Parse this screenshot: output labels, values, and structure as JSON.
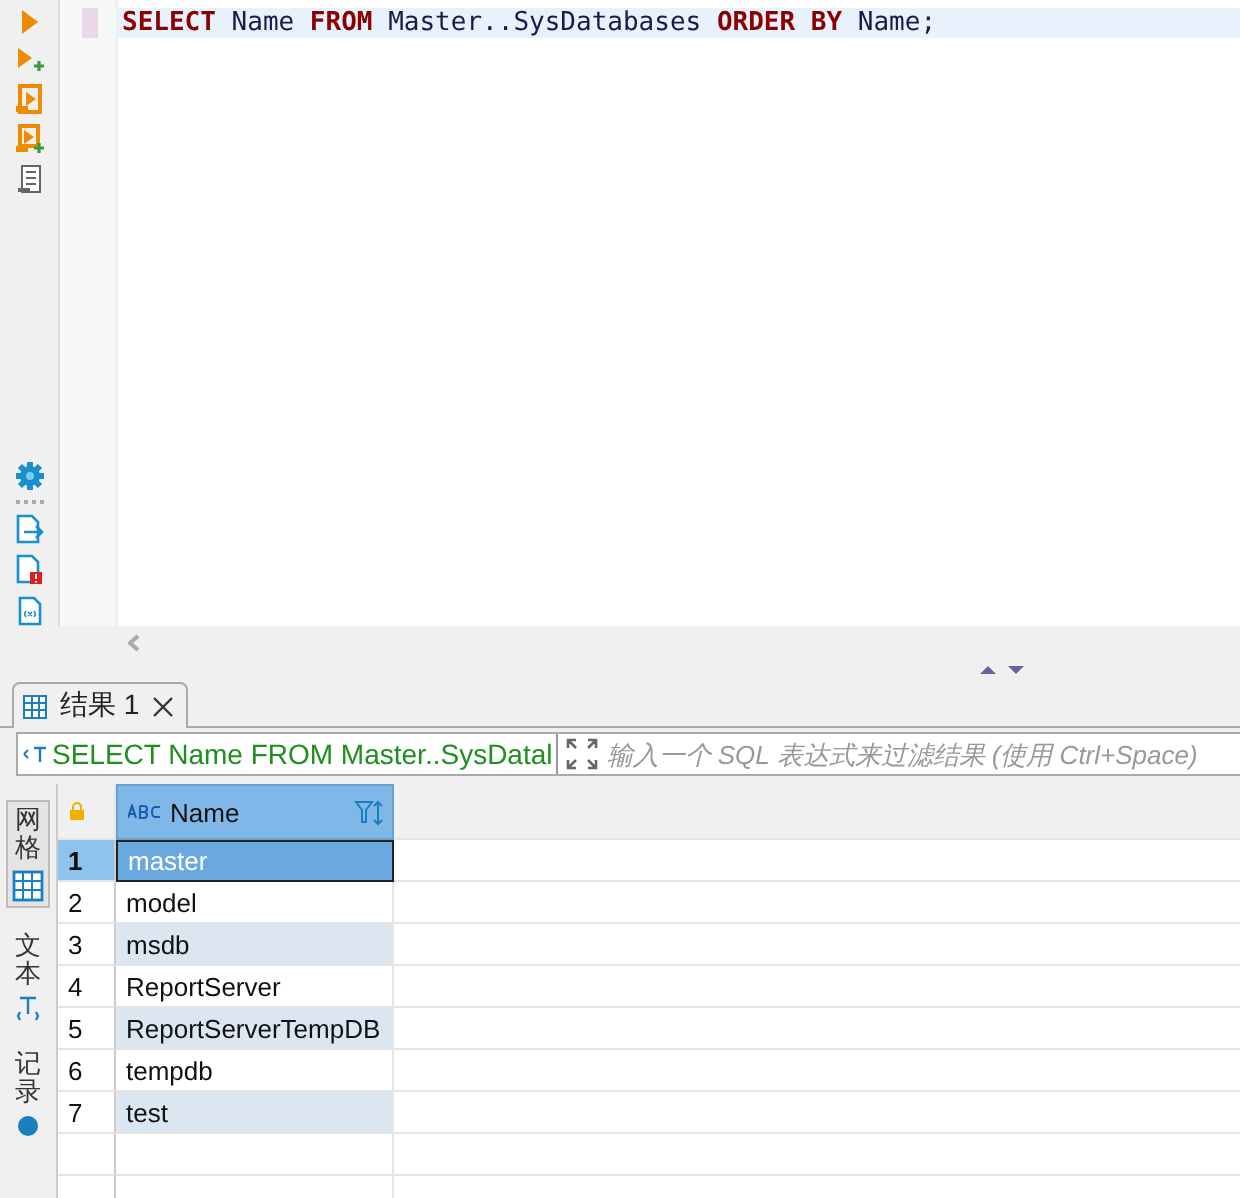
{
  "editor": {
    "tokens": [
      {
        "kind": "keyword",
        "text": "SELECT"
      },
      {
        "kind": "plain",
        "text": "Name"
      },
      {
        "kind": "keyword",
        "text": "FROM"
      },
      {
        "kind": "plain",
        "text": "Master..SysDatabases"
      },
      {
        "kind": "keyword",
        "text": "ORDER BY"
      },
      {
        "kind": "plain",
        "text": "Name;"
      }
    ]
  },
  "result_tabs": [
    {
      "label": "结果 1",
      "selected": true
    }
  ],
  "filter": {
    "query": "SELECT Name FROM Master..SysDatal",
    "placeholder": "输入一个 SQL 表达式来过滤结果 (使用 Ctrl+Space)"
  },
  "side_tabs": [
    {
      "label": "网格",
      "selected": true
    },
    {
      "label": "文本",
      "selected": false
    },
    {
      "label": "记录",
      "selected": false
    }
  ],
  "table": {
    "columns": [
      "Name"
    ],
    "rows": [
      {
        "number": "1",
        "name": "master",
        "selected": true
      },
      {
        "number": "2",
        "name": "model",
        "selected": false
      },
      {
        "number": "3",
        "name": "msdb",
        "selected": false
      },
      {
        "number": "4",
        "name": "ReportServer",
        "selected": false
      },
      {
        "number": "5",
        "name": "ReportServerTempDB",
        "selected": false
      },
      {
        "number": "6",
        "name": "tempdb",
        "selected": false
      },
      {
        "number": "7",
        "name": "test",
        "selected": false
      }
    ]
  }
}
